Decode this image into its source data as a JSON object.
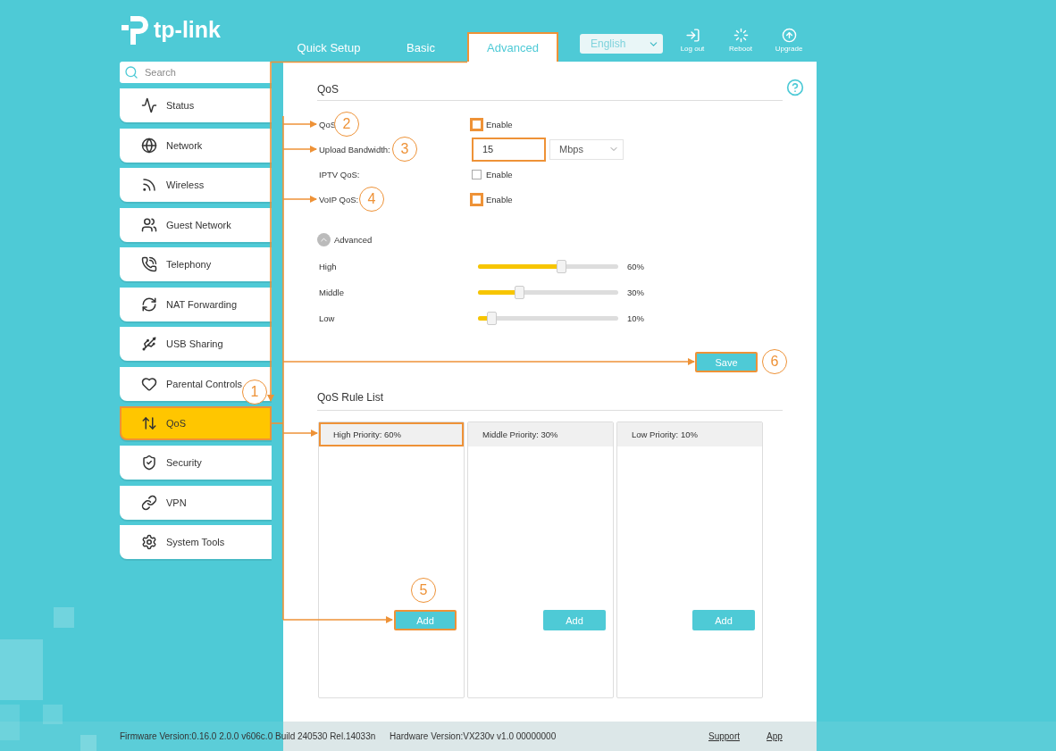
{
  "logo": {
    "text": "tp-link"
  },
  "tabs": [
    {
      "label": "Quick Setup",
      "selected": false,
      "highlighted": false
    },
    {
      "label": "Basic",
      "selected": false,
      "highlighted": false
    },
    {
      "label": "Advanced",
      "selected": true,
      "highlighted": true
    }
  ],
  "language": {
    "value": "English"
  },
  "header_actions": [
    {
      "kind": "logout",
      "label": "Log out"
    },
    {
      "kind": "reboot",
      "label": "Reboot"
    },
    {
      "kind": "upgrade",
      "label": "Upgrade"
    }
  ],
  "sidebar": {
    "search": {
      "placeholder": "Search"
    },
    "items": [
      {
        "kind": "status",
        "label": "Status",
        "selected": false,
        "highlighted": false
      },
      {
        "kind": "network",
        "label": "Network",
        "selected": false,
        "highlighted": false
      },
      {
        "kind": "wireless",
        "label": "Wireless",
        "selected": false,
        "highlighted": false
      },
      {
        "kind": "guest",
        "label": "Guest Network",
        "selected": false,
        "highlighted": false
      },
      {
        "kind": "telephony",
        "label": "Telephony",
        "selected": false,
        "highlighted": false
      },
      {
        "kind": "nat",
        "label": "NAT Forwarding",
        "selected": false,
        "highlighted": false
      },
      {
        "kind": "usb",
        "label": "USB Sharing",
        "selected": false,
        "highlighted": false
      },
      {
        "kind": "parental",
        "label": "Parental Controls",
        "selected": false,
        "highlighted": false
      },
      {
        "kind": "qos",
        "label": "QoS",
        "selected": true,
        "highlighted": true
      },
      {
        "kind": "security",
        "label": "Security",
        "selected": false,
        "highlighted": false
      },
      {
        "kind": "vpn",
        "label": "VPN",
        "selected": false,
        "highlighted": false
      },
      {
        "kind": "tools",
        "label": "System Tools",
        "selected": false,
        "highlighted": false
      }
    ]
  },
  "qos": {
    "title": "QoS",
    "settings": [
      {
        "kind": "checkbox",
        "label": "QoS",
        "option": "Enable",
        "checked": false,
        "highlighted": true
      },
      {
        "kind": "field",
        "label": "Upload Bandwidth:",
        "value": "15",
        "unit": "Mbps",
        "highlighted": true
      },
      {
        "kind": "checkbox",
        "label": "IPTV QoS:",
        "option": "Enable",
        "checked": false,
        "highlighted": false
      },
      {
        "kind": "checkbox",
        "label": "VoIP QoS:",
        "option": "Enable",
        "checked": false,
        "highlighted": true
      }
    ],
    "advanced": {
      "label": "Advanced",
      "expanded": true
    },
    "priorities": [
      {
        "label": "High",
        "level": 0.6,
        "reading": "60%"
      },
      {
        "label": "Middle",
        "level": 0.3,
        "reading": "30%"
      },
      {
        "label": "Low",
        "level": 0.1,
        "reading": "10%"
      }
    ],
    "save": {
      "label": "Save",
      "highlighted": true
    }
  },
  "rule_list": {
    "title": "QoS Rule List",
    "columns": [
      {
        "header": "High Priority: 60%",
        "highlighted": true,
        "add": {
          "label": "Add",
          "highlighted": true
        }
      },
      {
        "header": "Middle Priority: 30%",
        "highlighted": false,
        "add": {
          "label": "Add",
          "highlighted": false
        }
      },
      {
        "header": "Low Priority: 10%",
        "highlighted": false,
        "add": {
          "label": "Add",
          "highlighted": false
        }
      }
    ]
  },
  "footer": {
    "firmware": "Firmware Version:0.16.0 2.0.0 v606c.0 Build 240530 Rel.14033n",
    "hardware": "Hardware Version:VX230v v1.0 00000000",
    "links": [
      "Support",
      "App"
    ]
  },
  "annotations": [
    {
      "label": "1"
    },
    {
      "label": "2"
    },
    {
      "label": "3"
    },
    {
      "label": "4"
    },
    {
      "label": "5"
    },
    {
      "label": "6"
    }
  ]
}
